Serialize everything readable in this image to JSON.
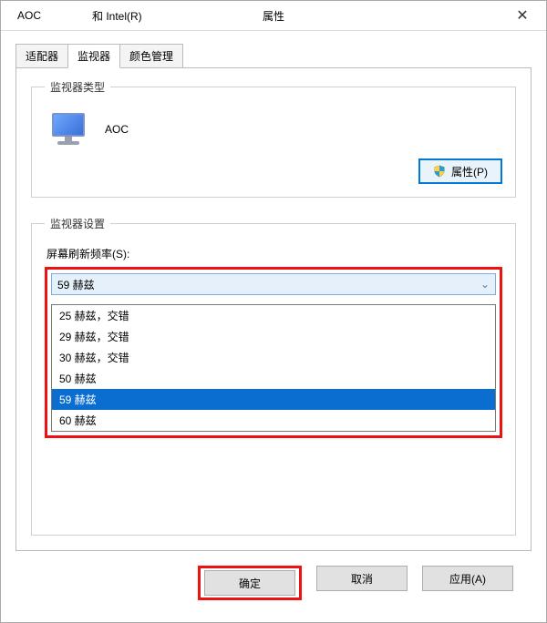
{
  "title": {
    "left": "AOC",
    "mid": "和 Intel(R)",
    "center": "属性"
  },
  "tabs": {
    "adapter": "适配器",
    "monitor": "监视器",
    "color": "颜色管理"
  },
  "group": {
    "type": "监视器类型",
    "settings": "监视器设置"
  },
  "type": {
    "name": "AOC"
  },
  "properties_btn": "属性(P)",
  "refresh": {
    "label": "屏幕刷新频率(S):",
    "selected": "59 赫兹",
    "options": [
      "25 赫兹，交错",
      "29 赫兹，交错",
      "30 赫兹，交错",
      "50 赫兹",
      "59 赫兹",
      "60 赫兹"
    ],
    "highlight": "59 赫兹"
  },
  "footer": {
    "ok": "确定",
    "cancel": "取消",
    "apply": "应用(A)"
  }
}
